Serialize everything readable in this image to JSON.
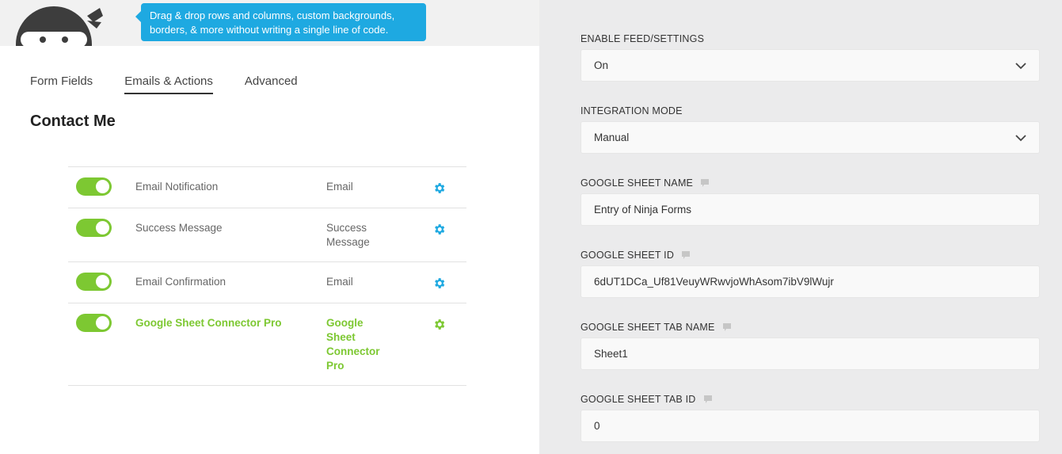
{
  "header": {
    "logo_name": "ninja-logo",
    "tooltip": "Drag & drop rows and columns, custom backgrounds, borders, & more without writing a single line of code."
  },
  "tabs": [
    {
      "label": "Form Fields",
      "active": false
    },
    {
      "label": "Emails & Actions",
      "active": true
    },
    {
      "label": "Advanced",
      "active": false
    }
  ],
  "form_title": "Contact Me",
  "actions": [
    {
      "name": "Email Notification",
      "type": "Email",
      "enabled": true
    },
    {
      "name": "Success Message",
      "type": "Success Message",
      "enabled": true
    },
    {
      "name": "Email Confirmation",
      "type": "Email",
      "enabled": true
    },
    {
      "name": "Google Sheet Connector Pro",
      "type": "Google Sheet Connector Pro",
      "enabled": true
    }
  ],
  "settings": {
    "enable_feed": {
      "label": "ENABLE FEED/SETTINGS",
      "value": "On"
    },
    "integration_mode": {
      "label": "INTEGRATION MODE",
      "value": "Manual"
    },
    "sheet_name": {
      "label": "GOOGLE SHEET NAME",
      "value": "Entry of Ninja Forms"
    },
    "sheet_id": {
      "label": "GOOGLE SHEET ID",
      "value": "6dUT1DCa_Uf81VeuyWRwvjoWhAsom7ibV9lWujr"
    },
    "tab_name": {
      "label": "GOOGLE SHEET TAB NAME",
      "value": "Sheet1"
    },
    "tab_id": {
      "label": "GOOGLE SHEET TAB ID",
      "value": "0"
    }
  },
  "colors": {
    "accent_green": "#7dc832",
    "tooltip_blue": "#1ea9e1",
    "gear_blue": "#1ea9e1"
  }
}
